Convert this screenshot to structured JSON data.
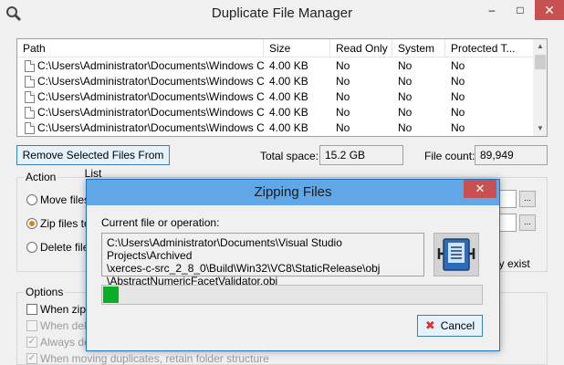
{
  "window": {
    "title": "Duplicate File Manager",
    "icon": "magnifier-icon",
    "minimize": "–",
    "maximize": "□",
    "close": "✕"
  },
  "file_list": {
    "columns": [
      "Path",
      "Size",
      "Read Only",
      "System",
      "Protected T..."
    ],
    "rows": [
      {
        "path": "C:\\Users\\Administrator\\Documents\\Windows Certif...",
        "size": "4.00 KB",
        "read_only": "No",
        "system": "No",
        "protected": "No"
      },
      {
        "path": "C:\\Users\\Administrator\\Documents\\Windows Certif...",
        "size": "4.00 KB",
        "read_only": "No",
        "system": "No",
        "protected": "No"
      },
      {
        "path": "C:\\Users\\Administrator\\Documents\\Windows Certif...",
        "size": "4.00 KB",
        "read_only": "No",
        "system": "No",
        "protected": "No"
      },
      {
        "path": "C:\\Users\\Administrator\\Documents\\Windows Certif...",
        "size": "4.00 KB",
        "read_only": "No",
        "system": "No",
        "protected": "No"
      },
      {
        "path": "C:\\Users\\Administrator\\Documents\\Windows Certif...",
        "size": "4.00 KB",
        "read_only": "No",
        "system": "No",
        "protected": "No"
      }
    ],
    "scroll_up": "▲",
    "scroll_down": "▼"
  },
  "summary": {
    "remove_button": "Remove Selected Files From List",
    "total_space_label": "Total space:",
    "total_space_value": "15.2 GB",
    "file_count_label": "File count:",
    "file_count_value": "89,949"
  },
  "action": {
    "group_label": "Action",
    "options": [
      {
        "label": "Move files",
        "selected": false
      },
      {
        "label": "Zip files to:",
        "selected": true
      },
      {
        "label": "Delete files",
        "selected": false
      }
    ],
    "browse": "...",
    "trailing_text": "dy exist"
  },
  "options": {
    "group_label": "Options",
    "items": [
      {
        "label": "When zippi",
        "checked": false,
        "enabled": true
      },
      {
        "label": "When dele",
        "checked": false,
        "enabled": false
      },
      {
        "label": "Always del",
        "checked": true,
        "enabled": false
      },
      {
        "label": "When moving duplicates, retain folder structure",
        "checked": true,
        "enabled": false
      }
    ]
  },
  "dialog": {
    "title": "Zipping Files",
    "close": "✕",
    "operation_label": "Current file or operation:",
    "current_file": "C:\\Users\\Administrator\\Documents\\Visual Studio Projects\\Archived\n\\xerces-c-src_2_8_0\\Build\\Win32\\VC8\\StaticRelease\\obj\n\\AbstractNumericFacetValidator.obj",
    "progress_fraction": 0.042,
    "cancel_label": "Cancel",
    "cancel_icon": "✖",
    "icon": "zip-archive-icon"
  },
  "colors": {
    "accent": "#60a7e8",
    "progress": "#06b025",
    "close": "#c75050",
    "cancel_x": "#d9352b"
  }
}
